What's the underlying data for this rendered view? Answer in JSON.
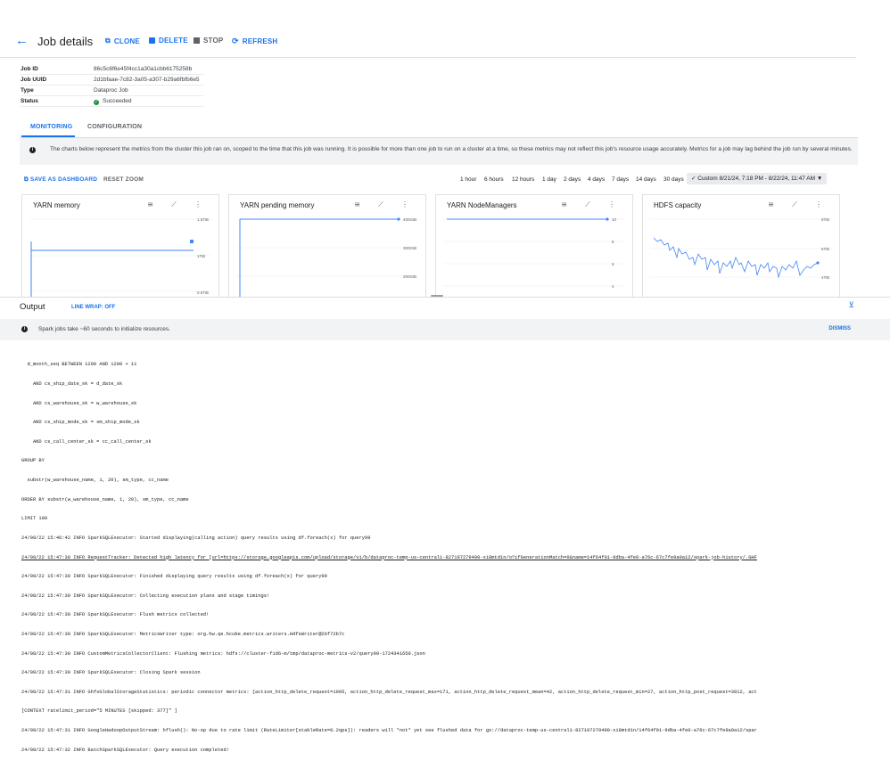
{
  "header": {
    "title": "Job details",
    "actions": {
      "clone": "CLONE",
      "delete": "DELETE",
      "stop": "STOP",
      "refresh": "REFRESH"
    }
  },
  "job": [
    {
      "key": "Job ID",
      "value": "86c5c6f6e45f4cc1a30a1cbb6175258b"
    },
    {
      "key": "Job UUID",
      "value": "2d1bfaae-7c82-3a05-a307-b29a6fbfb6e5"
    },
    {
      "key": "Type",
      "value": "Dataproc Job"
    },
    {
      "key": "Status",
      "value": "Succeeded"
    }
  ],
  "tabs": {
    "monitoring": "MONITORING",
    "configuration": "CONFIGURATION"
  },
  "banner": "The charts below represent the metrics from the cluster this job ran on, scoped to the time that this job was running. It is possible for more than one job to run on a cluster at a time, so these metrics may not reflect this job's resource usage accurately. Metrics for a job may lag behind the job run by several minutes.",
  "dashboard": {
    "save": "SAVE AS DASHBOARD",
    "reset": "RESET ZOOM",
    "ranges": [
      "1 hour",
      "6 hours",
      "12 hours",
      "1 day",
      "2 days",
      "4 days",
      "7 days",
      "14 days",
      "30 days"
    ],
    "custom": "✓  Custom 8/21/24, 7:18 PM - 8/22/24, 11:47 AM  ▼"
  },
  "charts": [
    {
      "title": "YARN memory",
      "ticks": [
        "1.5TiB",
        "1TiB",
        "0.5TiB"
      ]
    },
    {
      "title": "YARN pending memory",
      "ticks": [
        "400GiB",
        "300GiB",
        "200GiB"
      ]
    },
    {
      "title": "YARN NodeManagers",
      "ticks": [
        "10",
        "8",
        "6",
        "4"
      ]
    },
    {
      "title": "HDFS capacity",
      "ticks": [
        "8TiB",
        "6TiB",
        "4TiB"
      ]
    }
  ],
  "chart_icons": "≅ ⟋ ⋮",
  "output": {
    "title": "Output",
    "line_wrap": "LINE WRAP: OFF",
    "notice": "Spark jobs take ~60 seconds to initialize resources.",
    "dismiss": "DISMISS",
    "log": [
      "  d_month_seq BETWEEN 1200 AND 1200 + 11",
      "    AND cs_ship_date_sk = d_date_sk",
      "    AND cs_warehouse_sk = w_warehouse_sk",
      "    AND cs_ship_mode_sk = sm_ship_mode_sk",
      "    AND cs_call_center_sk = cc_call_center_sk",
      "GROUP BY",
      "  substr(w_warehouse_name, 1, 20), sm_type, cc_name",
      "ORDER BY substr(w_warehouse_name, 1, 20), sm_type, cc_name",
      "LIMIT 100",
      "24/08/22 15:46:42 INFO SparkSQLExecutor: Started displaying(calling action) query results using df.foreach(x) for query99",
      "24/08/22 15:47:30 INFO RequestTracker: Detected high latency for [url=https://storage.googleapis.com/upload/storage/v1/b/dataproc-temp-us-central1-827197279490-xi8mtd1n/o?ifGenerationMatch=0&name=14f64f01-9dba-4fe0-a76c-67c7fe9a0a12/spark-job-history/.GHF",
      "24/08/22 15:47:30 INFO SparkSQLExecutor: Finished displaying query results using df.foreach(x) for query99",
      "24/08/22 15:47:30 INFO SparkSQLExecutor: Collecting execution plans and stage timings!",
      "24/08/22 15:47:30 INFO SparkSQLExecutor: Flush metrics collected!",
      "24/08/22 15:47:30 INFO SparkSQLExecutor: MetricsWriter type: org.hw.qe.hcube.metrics.writers.HdfsWriter@26f72b7c",
      "24/08/22 15:47:30 INFO CustomMetricsCollectorClient: Flushing metrics: hdfs://cluster-f1d6-m/tmp/dataproc-metrics-v2/query99-1724341650.json",
      "24/08/22 15:47:30 INFO SparkSQLExecutor: Closing Spark session",
      "24/08/22 15:47:31 INFO GhfsGlobalStorageStatistics: periodic connector metrics: {action_http_delete_request=1905, action_http_delete_request_max=171, action_http_delete_request_mean=42, action_http_delete_request_min=27, action_http_post_request=3812, act",
      "[CONTEXT ratelimit_period=\"5 MINUTES [skipped: 377]\" ]",
      "24/08/22 15:47:31 INFO GoogleHadoopOutputStream: hflush(): No-op due to rate limit (RateLimiter[stableRate=0.2qps]): readers will *not* yet see flushed data for gs://dataproc-temp-us-central1-827197279490-xi8mtd1n/14f64f01-9dba-4fe0-a76c-67c7fe9a0a12/spar",
      "24/08/22 15:47:32 INFO BatchSparkSQLExecutor: Query execution completed!"
    ]
  }
}
